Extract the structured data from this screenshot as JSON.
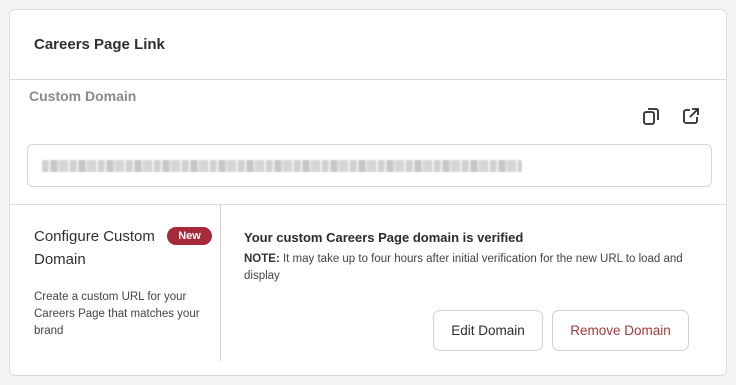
{
  "header": {
    "title": "Careers Page Link"
  },
  "custom_domain": {
    "label": "Custom Domain",
    "copy_icon": "copy-icon",
    "external_icon": "external-link-icon"
  },
  "configure": {
    "title": "Configure Custom Domain",
    "badge": "New",
    "description": "Create a custom URL for your Careers Page that matches your brand"
  },
  "status": {
    "title": "Your custom Careers Page domain is verified",
    "note_label": "NOTE:",
    "note_text": " It may take up to four hours after initial verification for the new URL to load and display"
  },
  "actions": {
    "edit_label": "Edit Domain",
    "remove_label": "Remove Domain"
  },
  "colors": {
    "badge_bg": "#a52a3a",
    "remove_text": "#a33a3a"
  }
}
